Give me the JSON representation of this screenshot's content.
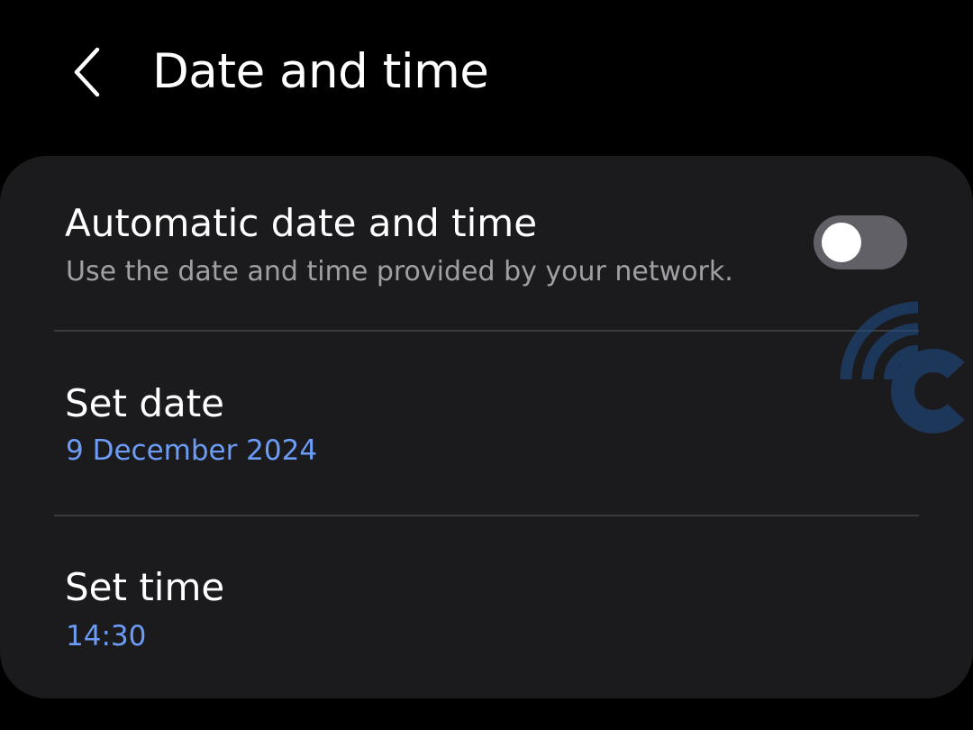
{
  "header": {
    "back_icon": "chevron-left-icon",
    "title": "Date and time"
  },
  "settings": {
    "automatic": {
      "title": "Automatic date and time",
      "subtitle": "Use the date and time provided by your network.",
      "toggle_on": false
    },
    "date": {
      "title": "Set date",
      "value": "9 December 2024"
    },
    "time": {
      "title": "Set time",
      "value": "14:30"
    }
  },
  "watermark": {
    "icon": "signal-c-logo-icon",
    "color": "#1f4e8c"
  },
  "colors": {
    "background": "#000000",
    "card": "#1b1b1e",
    "accent_value": "#6c9cf5",
    "subtitle": "#a0a0a4",
    "toggle_track_off": "#606066"
  }
}
